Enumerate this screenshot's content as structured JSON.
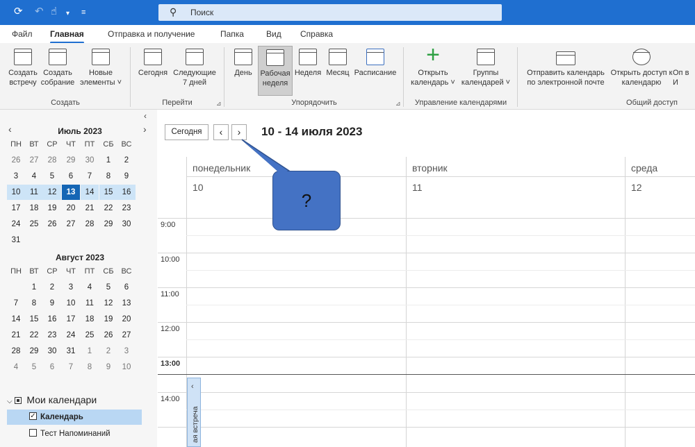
{
  "search": {
    "placeholder": "Поиск"
  },
  "menu": {
    "tabs": [
      {
        "label": "Файл"
      },
      {
        "label": "Главная",
        "active": true
      },
      {
        "label": "Отправка и получение"
      },
      {
        "label": "Папка"
      },
      {
        "label": "Вид"
      },
      {
        "label": "Справка"
      }
    ]
  },
  "ribbon": {
    "new": {
      "label": "Создать",
      "new_appointment": "Создать встречу",
      "new_meeting": "Создать собрание",
      "new_items": "Новые элементы ˅"
    },
    "goto": {
      "label": "Перейти",
      "today": "Сегодня",
      "next7": "Следующие 7 дней"
    },
    "arrange": {
      "label": "Упорядочить",
      "day": "День",
      "work_week": "Рабочая неделя",
      "week": "Неделя",
      "month": "Месяц",
      "schedule": "Расписание"
    },
    "manage": {
      "label": "Управление календарями",
      "open_calendar": "Открыть календарь ˅",
      "calendar_groups": "Группы календарей ˅"
    },
    "share": {
      "label": "Общий доступ",
      "email_calendar": "Отправить календарь по электронной почте",
      "share_calendar": "Открыть доступ к календарю",
      "publish_partial": "Оп в И"
    }
  },
  "minical": {
    "dow": [
      "ПН",
      "ВТ",
      "СР",
      "ЧТ",
      "ПТ",
      "СБ",
      "ВС"
    ],
    "july": {
      "title": "Июль 2023",
      "weeks": [
        [
          "26",
          "27",
          "28",
          "29",
          "30",
          "1",
          "2"
        ],
        [
          "3",
          "4",
          "5",
          "6",
          "7",
          "8",
          "9"
        ],
        [
          "10",
          "11",
          "12",
          "13",
          "14",
          "15",
          "16"
        ],
        [
          "17",
          "18",
          "19",
          "20",
          "21",
          "22",
          "23"
        ],
        [
          "24",
          "25",
          "26",
          "27",
          "28",
          "29",
          "30"
        ],
        [
          "31"
        ]
      ]
    },
    "august": {
      "title": "Август 2023",
      "weeks": [
        [
          "",
          "1",
          "2",
          "3",
          "4",
          "5",
          "6"
        ],
        [
          "7",
          "8",
          "9",
          "10",
          "11",
          "12",
          "13"
        ],
        [
          "14",
          "15",
          "16",
          "17",
          "18",
          "19",
          "20"
        ],
        [
          "21",
          "22",
          "23",
          "24",
          "25",
          "26",
          "27"
        ],
        [
          "28",
          "29",
          "30",
          "31",
          "1",
          "2",
          "3"
        ],
        [
          "4",
          "5",
          "6",
          "7",
          "8",
          "9",
          "10"
        ]
      ]
    }
  },
  "my_calendars": {
    "title": "Мои календари",
    "items": [
      {
        "label": "Календарь",
        "checked": true,
        "selected": true
      },
      {
        "label": "Тест Напоминаний",
        "checked": false
      }
    ]
  },
  "calendar": {
    "today_button": "Сегодня",
    "date_range": "10 - 14 июля 2023",
    "days": [
      {
        "name": "понедельник",
        "num": "10"
      },
      {
        "name": "вторник",
        "num": "11"
      },
      {
        "name": "среда",
        "num": "12"
      }
    ],
    "times": [
      "9:00",
      "10:00",
      "11:00",
      "12:00",
      "13:00",
      "14:00"
    ],
    "appointment_tab": "ая встреча"
  },
  "callout": {
    "text": "?"
  },
  "colors": {
    "accent": "#1f6fd0",
    "today": "#1566b5",
    "callout": "#4472c4"
  }
}
